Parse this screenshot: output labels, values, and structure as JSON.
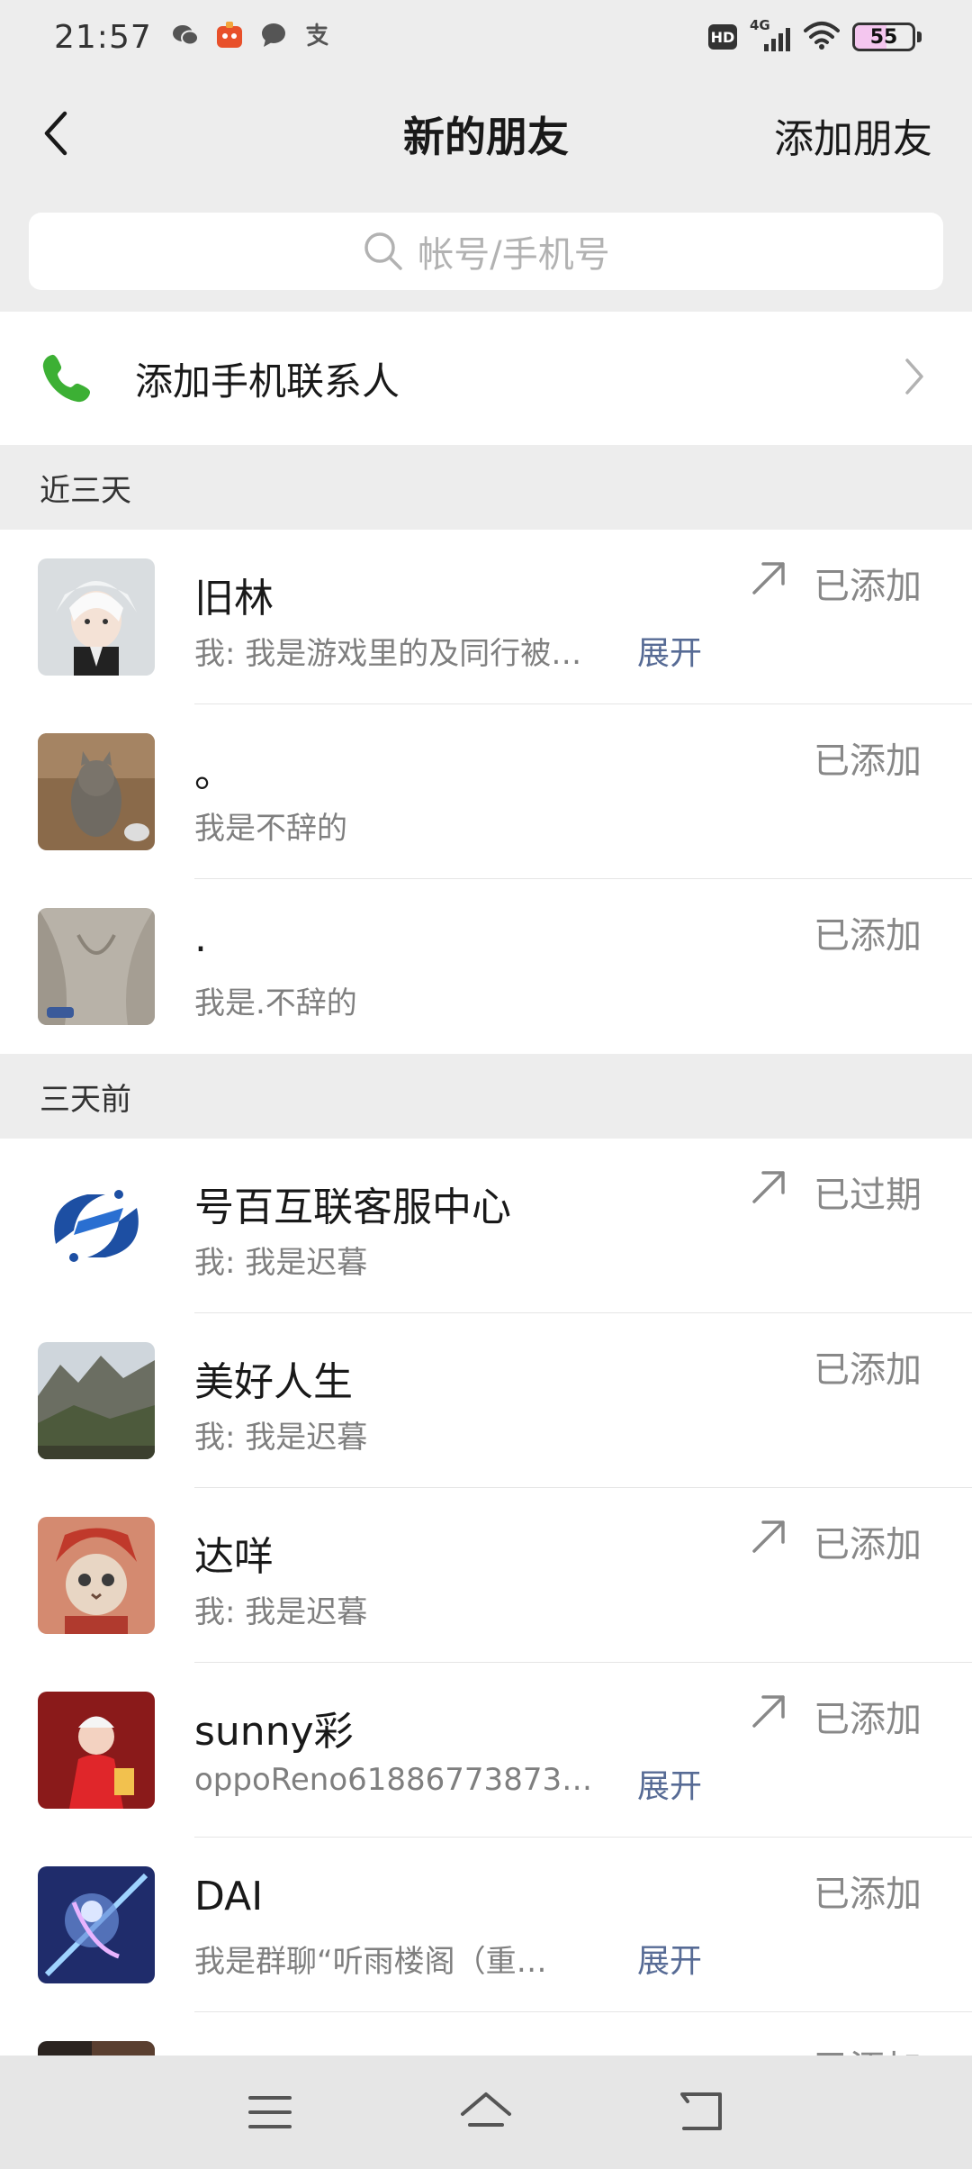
{
  "status_bar": {
    "time": "21:57",
    "hd_badge": "HD",
    "network": "4G",
    "battery_level": "55",
    "battery_fraction": 0.55,
    "notification_icons": [
      "wechat-icon",
      "app-icon",
      "chat-bubble-icon",
      "alipay-icon"
    ]
  },
  "nav": {
    "title": "新的朋友",
    "action_label": "添加朋友"
  },
  "search": {
    "placeholder": "帐号/手机号"
  },
  "phone_contacts": {
    "label": "添加手机联系人"
  },
  "sections": [
    {
      "header": "近三天",
      "items": [
        {
          "name": "旧林",
          "message": "我: 我是游戏里的及同行被…",
          "expand": "展开",
          "status": "已添加",
          "outgoing": true,
          "avatar": "anime-character"
        },
        {
          "name": "。",
          "message": "我是不辞的",
          "expand": "",
          "status": "已添加",
          "outgoing": false,
          "avatar": "cat-photo"
        },
        {
          "name": ".",
          "message": "我是.不辞的",
          "expand": "",
          "status": "已添加",
          "outgoing": false,
          "avatar": "sweater-photo"
        }
      ]
    },
    {
      "header": "三天前",
      "items": [
        {
          "name": "号百互联客服中心",
          "message": "我: 我是迟暮",
          "expand": "",
          "status": "已过期",
          "outgoing": true,
          "avatar": "logo"
        },
        {
          "name": "美好人生",
          "message": "我: 我是迟暮",
          "expand": "",
          "status": "已添加",
          "outgoing": false,
          "avatar": "mountain-photo"
        },
        {
          "name": "达咩",
          "message": "我: 我是迟暮",
          "expand": "",
          "status": "已添加",
          "outgoing": true,
          "avatar": "cat-costume"
        },
        {
          "name": "sunny彩",
          "message": "oppoReno61886773873…",
          "expand": "展开",
          "status": "已添加",
          "outgoing": true,
          "avatar": "child-red"
        },
        {
          "name": "DAI",
          "message": "我是群聊“听雨楼阁（重…",
          "expand": "展开",
          "status": "已添加",
          "outgoing": false,
          "avatar": "game-art"
        },
        {
          "name": "",
          "message": "",
          "expand": "",
          "status": "已添加",
          "outgoing": false,
          "avatar": "dark-photo"
        }
      ]
    }
  ],
  "colors": {
    "background": "#ededed",
    "link": "#576b95",
    "status_text": "#888888",
    "phone_green": "#3cb034"
  }
}
